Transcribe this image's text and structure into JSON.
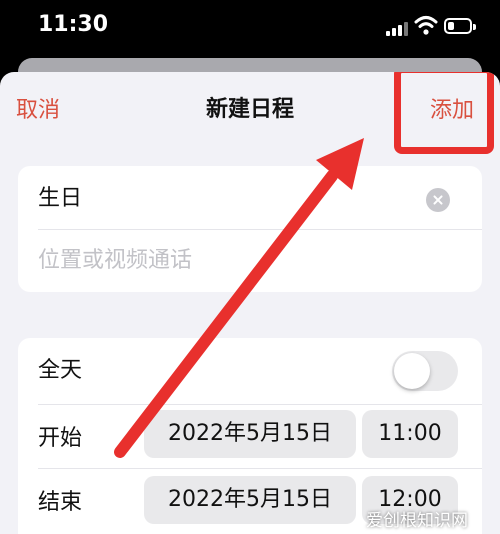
{
  "status_bar": {
    "time": "11:30",
    "icons": [
      "signal-icon",
      "wifi-icon",
      "battery-icon"
    ]
  },
  "nav": {
    "cancel_label": "取消",
    "title": "新建日程",
    "add_label": "添加"
  },
  "event": {
    "title_value": "生日",
    "location_placeholder": "位置或视频通话"
  },
  "schedule": {
    "all_day_label": "全天",
    "all_day_on": false,
    "start_label": "开始",
    "start_date": "2022年5月15日",
    "start_time": "11:00",
    "end_label": "结束",
    "end_date": "2022年5月15日",
    "end_time": "12:00"
  },
  "watermark": "爱创根知识网",
  "colors": {
    "accent": "#d9503f",
    "annotation": "#e8302d",
    "background": "#f2f2f7"
  }
}
